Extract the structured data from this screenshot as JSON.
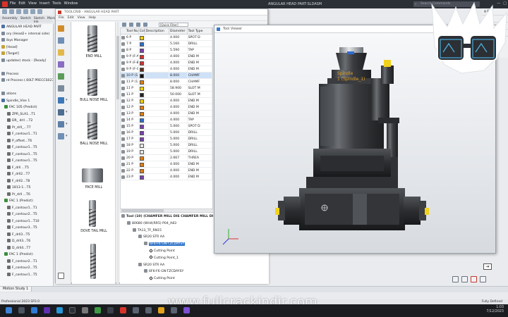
{
  "main_window": {
    "menu": [
      "File",
      "Edit",
      "View",
      "Insert",
      "Tools",
      "Window"
    ],
    "doc_title": "ANGULAR HEAD PART-SLDASM",
    "search_placeholder": "Search Commands",
    "command_tabs": [
      "Assembly",
      "Sketch",
      "Sketch Ink",
      "Markup"
    ]
  },
  "feature_tree": [
    {
      "text": "ANGULAR HEAD PART",
      "indent": 0,
      "color": "#4a6fa5"
    },
    {
      "text": "ory (Head2+ internal side)",
      "indent": 0,
      "color": "#7b8a9b"
    },
    {
      "text": "ibys Manager",
      "indent": 0,
      "color": "#7b8a9b"
    },
    {
      "text": "[Head]",
      "indent": 0,
      "color": "#c6a13b"
    },
    {
      "text": "[Target]",
      "indent": 0,
      "color": "#c6a13b"
    },
    {
      "text": "updates) stock - [Ready]",
      "indent": 0,
      "color": "#7b8a9b"
    },
    {
      "text": "",
      "indent": 0,
      "color": ""
    },
    {
      "text": "Process",
      "indent": 0,
      "color": "#7b8a9b"
    },
    {
      "text": "nt Process (.60LT PRECCS023 - 56EXEC4)",
      "indent": 0,
      "color": "#7b8a9b"
    },
    {
      "text": "",
      "indent": 0,
      "color": ""
    },
    {
      "text": "ations",
      "indent": 0,
      "color": "#7b8a9b"
    },
    {
      "text": "Spindle_Vise 1",
      "indent": 0,
      "color": "#4a6fa5"
    },
    {
      "text": "FAC 105 (Predict)",
      "indent": 1,
      "color": "#3c8d3c"
    },
    {
      "text": "ZPR_SLA1...T1",
      "indent": 2,
      "color": "#6d6d6d"
    },
    {
      "text": "DR_ drll ...T2",
      "indent": 2,
      "color": "#6d6d6d"
    },
    {
      "text": "Pr_drll_...T7",
      "indent": 2,
      "color": "#6d6d6d"
    },
    {
      "text": "F_contour1...T1",
      "indent": 2,
      "color": "#6d6d6d"
    },
    {
      "text": "P_offset...T6",
      "indent": 2,
      "color": "#6d6d6d"
    },
    {
      "text": "F_contour1...T5",
      "indent": 2,
      "color": "#6d6d6d"
    },
    {
      "text": "F_contour1...T5",
      "indent": 2,
      "color": "#6d6d6d"
    },
    {
      "text": "F_contour1...T5",
      "indent": 2,
      "color": "#6d6d6d"
    },
    {
      "text": "F_drll ...T5",
      "indent": 2,
      "color": "#6d6d6d"
    },
    {
      "text": "F_drll2...T7",
      "indent": 2,
      "color": "#6d6d6d"
    },
    {
      "text": "F_drll2...T8",
      "indent": 2,
      "color": "#6d6d6d"
    },
    {
      "text": "1813-1...T5",
      "indent": 2,
      "color": "#6d6d6d"
    },
    {
      "text": "Pr_drll ...T6",
      "indent": 2,
      "color": "#6d6d6d"
    },
    {
      "text": "FAC 1 (Predict)",
      "indent": 1,
      "color": "#3c8d3c"
    },
    {
      "text": "F_contour1...T1",
      "indent": 2,
      "color": "#6d6d6d"
    },
    {
      "text": "F_contour2...T5",
      "indent": 2,
      "color": "#6d6d6d"
    },
    {
      "text": "F_contour1...T10",
      "indent": 2,
      "color": "#6d6d6d"
    },
    {
      "text": "F_contour3...T5",
      "indent": 2,
      "color": "#6d6d6d"
    },
    {
      "text": "F_drll3...T5",
      "indent": 2,
      "color": "#6d6d6d"
    },
    {
      "text": "D_drll3...T6",
      "indent": 2,
      "color": "#6d6d6d"
    },
    {
      "text": "D_drll4...T7",
      "indent": 2,
      "color": "#6d6d6d"
    },
    {
      "text": "FAC 1 (Predict)",
      "indent": 1,
      "color": "#3c8d3c"
    },
    {
      "text": "F_contour2...T1",
      "indent": 2,
      "color": "#6d6d6d"
    },
    {
      "text": "F_contour2...T5",
      "indent": 2,
      "color": "#6d6d6d"
    },
    {
      "text": "F_contour1...T5",
      "indent": 2,
      "color": "#6d6d6d"
    }
  ],
  "bottom_tabs": [
    "Motion Study 1"
  ],
  "status": {
    "left": "Professional 2023 SP3.0",
    "right": "Fully Defined"
  },
  "right_strip": [
    "g & B",
    "OOI",
    "ter Ti",
    "ne"
  ],
  "crib_window": {
    "title": "TOOLCRIB - ANGULAR HEAD PART",
    "menu": [
      "File",
      "Edit",
      "View",
      "Help"
    ],
    "filter_label": "[Quick Filter]"
  },
  "tool_gallery": [
    {
      "label": "END MILL",
      "kind": "end"
    },
    {
      "label": "BULL NOSE MILL",
      "kind": "bull"
    },
    {
      "label": "BALL NOSE MILL",
      "kind": "ball"
    },
    {
      "label": "FACE MILL",
      "kind": "face"
    },
    {
      "label": "DOVE TAIL MILL",
      "kind": "dove"
    },
    {
      "label": "",
      "kind": "drill"
    }
  ],
  "tool_table": {
    "headers": [
      "Tool Number",
      "Color",
      "Description",
      "Diameter",
      "Tool Type"
    ],
    "rows": [
      {
        "num": "6 P",
        "color": "#f0d000",
        "dia": "4.000",
        "type": "SPOT D"
      },
      {
        "num": "7 P",
        "color": "#2a6fd0",
        "dia": "5.160",
        "type": "DRILL"
      },
      {
        "num": "8 P",
        "color": "#7a3fb0",
        "dia": "5.590",
        "type": "TAP"
      },
      {
        "num": "9 P (F-A)",
        "color": "#d6302e",
        "dia": "4.000",
        "type": "END M"
      },
      {
        "num": "9 P (F-B)",
        "color": "#d6302e",
        "dia": "4.000",
        "type": "END M"
      },
      {
        "num": "9 P (F-C)",
        "color": "#5b2f1a",
        "dia": "4.000",
        "type": "END M"
      },
      {
        "num": "10 P (1...",
        "color": "#111111",
        "dia": "8.000",
        "type": "CHAMF"
      },
      {
        "num": "11 P (1...",
        "color": "#e07e10",
        "dia": "8.000",
        "type": "CHAMF"
      },
      {
        "num": "11 P",
        "color": "#f0d000",
        "dia": "58.900",
        "type": "SLOT M"
      },
      {
        "num": "11 P",
        "color": "#222222",
        "dia": "50.000",
        "type": "SLOT M"
      },
      {
        "num": "12 P",
        "color": "#f0d000",
        "dia": "4.000",
        "type": "END M"
      },
      {
        "num": "12 P",
        "color": "#e07e10",
        "dia": "4.000",
        "type": "END M"
      },
      {
        "num": "13 P",
        "color": "#e07e10",
        "dia": "4.000",
        "type": "END M"
      },
      {
        "num": "14 P",
        "color": "#2a6fd0",
        "dia": "4.000",
        "type": "TAP"
      },
      {
        "num": "15 P",
        "color": "#7a3fb0",
        "dia": "5.000",
        "type": "SPOT D"
      },
      {
        "num": "16 P",
        "color": "#7a3fb0",
        "dia": "5.000",
        "type": "DRILL"
      },
      {
        "num": "17 P",
        "color": "#7a3fb0",
        "dia": "5.000",
        "type": "DRILL"
      },
      {
        "num": "18 P",
        "color": "#e6e6e6",
        "dia": "5.000",
        "type": "DRILL"
      },
      {
        "num": "19 P",
        "color": "#e6e6e6",
        "dia": "5.000",
        "type": "DRILL"
      },
      {
        "num": "20 P",
        "color": "#e07e10",
        "dia": "2.667",
        "type": "THREA"
      },
      {
        "num": "21 P",
        "color": "#e07e10",
        "dia": "4.000",
        "type": "END M"
      },
      {
        "num": "22 P",
        "color": "#e07e10",
        "dia": "4.000",
        "type": "END M"
      },
      {
        "num": "23 P",
        "color": "#7a3fb0",
        "dia": "4.000",
        "type": "END M"
      }
    ],
    "selected_index": 6
  },
  "assembly_tree": [
    {
      "text": "Tool (10) (CHAMFER MILL DIS CHAMFER MILL DI",
      "x": 2,
      "bold": true,
      "icon": "box"
    },
    {
      "text": "80680 (WH4(RR5) P04_A83",
      "x": 10,
      "bold": false,
      "icon": "box"
    },
    {
      "text": "TA13_TF_RN15",
      "x": 18,
      "bold": false,
      "icon": "box"
    },
    {
      "text": "SR20 STR AA",
      "x": 26,
      "bold": false,
      "icon": "box"
    },
    {
      "text": "6F6-F6 GN-TZCDAYSY",
      "x": 34,
      "bold": false,
      "icon": "box",
      "selected": true
    },
    {
      "text": "Cutting Point",
      "x": 42,
      "bold": false,
      "icon": "diamond"
    },
    {
      "text": "Cutting Point_1",
      "x": 42,
      "bold": false,
      "icon": "diamond"
    },
    {
      "text": "SR20 STR AA",
      "x": 26,
      "bold": false,
      "icon": "box"
    },
    {
      "text": "6F6-F6 GN-TZCDAYSY",
      "x": 34,
      "bold": false,
      "icon": "box"
    },
    {
      "text": "Cutting Point",
      "x": 42,
      "bold": false,
      "icon": "diamond"
    }
  ],
  "viewer": {
    "title": "Tool Viewer",
    "spindle_label_1": "Spindle",
    "spindle_label_2": "1 (Spindle_1)"
  },
  "watermark": "www.fullcrackindir.com",
  "taskbar": {
    "time": "1:03",
    "date": "7/12/2023"
  },
  "colors": {
    "selection_blue": "#2f73c9",
    "row_selected": "#cfe1f6",
    "accent_red": "#d8332a"
  }
}
